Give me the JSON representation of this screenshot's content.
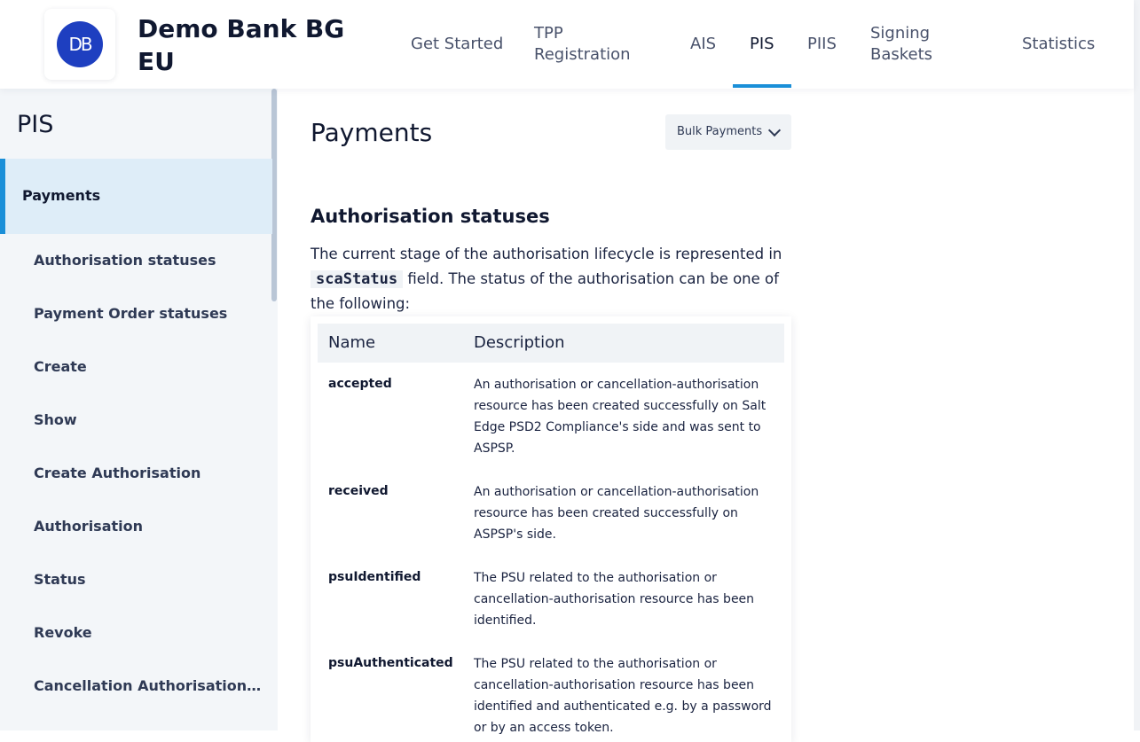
{
  "header": {
    "logo_text": "DB",
    "brand_name": "Demo Bank BG EU",
    "nav": [
      {
        "label": "Get Started"
      },
      {
        "label": "TPP Registration"
      },
      {
        "label": "AIS"
      },
      {
        "label": "PIS"
      },
      {
        "label": "PIIS"
      },
      {
        "label": "Signing Baskets"
      },
      {
        "label": "Statistics"
      }
    ],
    "active_nav": "PIS",
    "accent_color": "#1a8fd8"
  },
  "sidebar": {
    "title": "PIS",
    "active_item": "Payments",
    "items": [
      {
        "label": "Authorisation statuses"
      },
      {
        "label": "Payment Order statuses"
      },
      {
        "label": "Create"
      },
      {
        "label": "Show"
      },
      {
        "label": "Create Authorisation"
      },
      {
        "label": "Authorisation"
      },
      {
        "label": "Status"
      },
      {
        "label": "Revoke"
      },
      {
        "label": "Cancellation Authorisations o..."
      }
    ]
  },
  "main": {
    "title": "Payments",
    "dropdown_value": "Bulk Payments",
    "section_title": "Authorisation statuses",
    "paragraph_before": "The current stage of the authorisation lifecycle is represented in",
    "paragraph_code": "scaStatus",
    "paragraph_after": "field. The status of the authorisation can be one of the following:",
    "table": {
      "headers": [
        "Name",
        "Description"
      ],
      "rows": [
        {
          "name": "accepted",
          "description": "An authorisation or cancellation-authorisation resource has been created successfully on Salt Edge PSD2 Compliance's side and was sent to ASPSP."
        },
        {
          "name": "received",
          "description": "An authorisation or cancellation-authorisation resource has been created successfully on ASPSP's side."
        },
        {
          "name": "psuIdentified",
          "description": "The PSU related to the authorisation or cancellation-authorisation resource has been identified."
        },
        {
          "name": "psuAuthenticated",
          "description": "The PSU related to the authorisation or cancellation-authorisation resource has been identified and authenticated e.g. by a password or by an access token."
        }
      ]
    }
  }
}
